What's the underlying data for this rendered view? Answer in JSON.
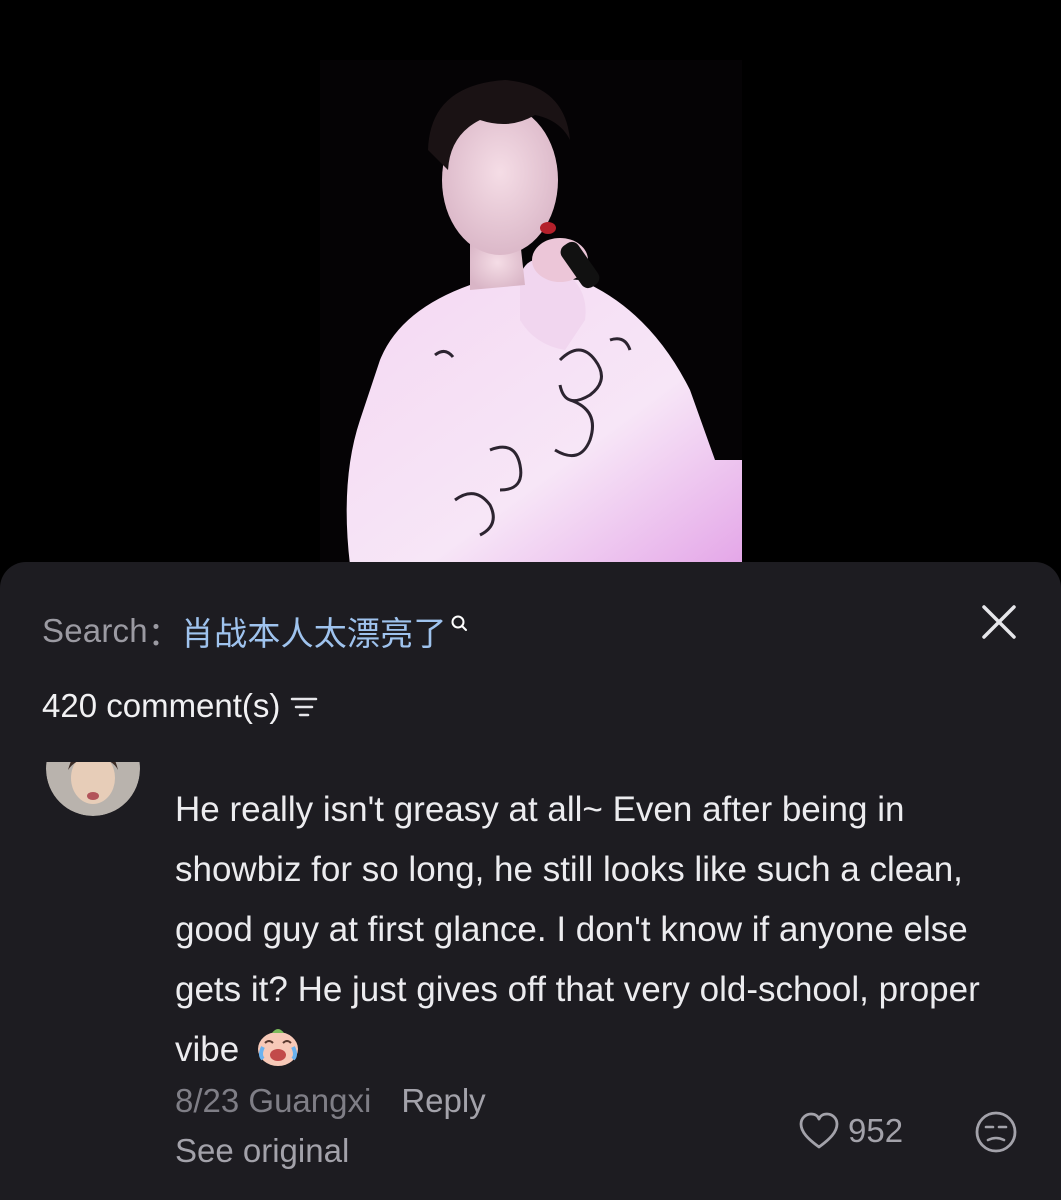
{
  "search": {
    "label": "Search",
    "separator": "：",
    "query": "肖战本人太漂亮了"
  },
  "comments_header": {
    "count_text": "420 comment(s)"
  },
  "comment": {
    "text": "He really isn't greasy at all~ Even after being in showbiz for so long, he still looks like such a clean, good guy at first glance. I don't know if anyone else gets it? He just gives off that very old-school, proper vibe",
    "emoji": "laughing-crying-face",
    "date_location": "8/23 Guangxi",
    "reply_label": "Reply",
    "see_original_label": "See original",
    "like_count": "952"
  },
  "colors": {
    "sheet_background": "#1d1c21",
    "query_link": "#9fc3ee",
    "secondary_text": "#a3a2aa"
  }
}
